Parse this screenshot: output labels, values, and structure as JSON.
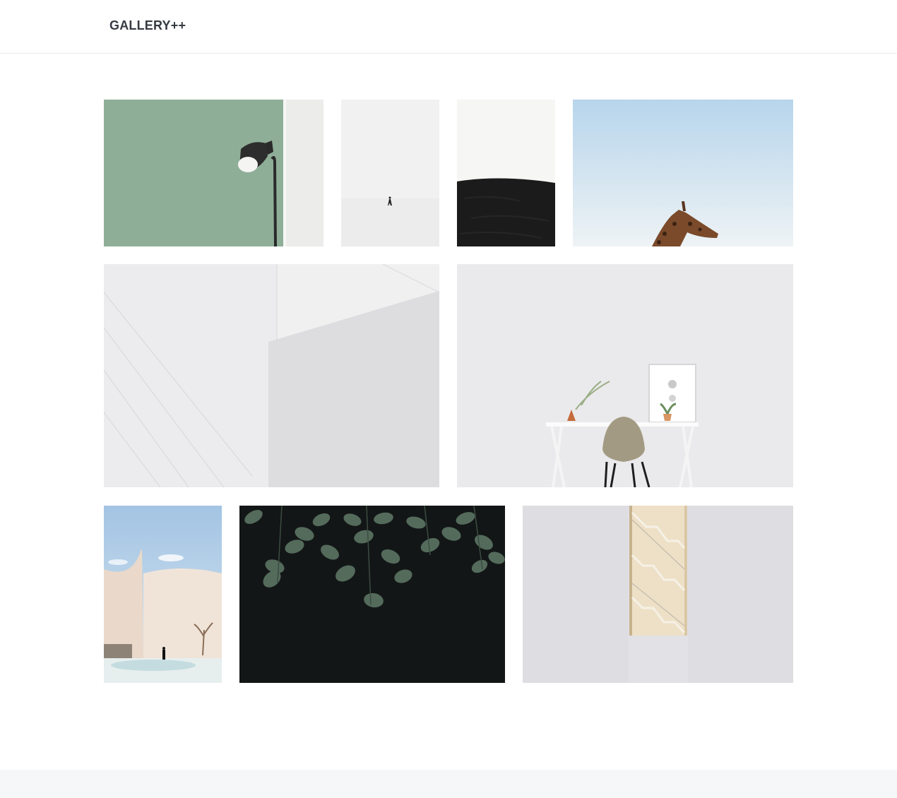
{
  "header": {
    "brand": "GALLERY++"
  },
  "gallery": {
    "photos": [
      {
        "subject": "floor-lamp-against-green-wall",
        "palette": [
          "#8fae98",
          "#ececeb",
          "#2b2b2b"
        ]
      },
      {
        "subject": "lone-person-walking-in-snow",
        "palette": [
          "#f1f1f1",
          "#1c1c1c"
        ]
      },
      {
        "subject": "black-sand-dune-white-sky",
        "palette": [
          "#f5f5f4",
          "#1c1c1c"
        ]
      },
      {
        "subject": "giraffe-against-blue-sky",
        "palette": [
          "#b9d7ec",
          "#e6eef2",
          "#7a4a2a"
        ]
      },
      {
        "subject": "white-architectural-walls",
        "palette": [
          "#ececee",
          "#d9d9dc"
        ]
      },
      {
        "subject": "white-desk-with-beige-chair",
        "palette": [
          "#eaeaec",
          "#a39a83",
          "#ffffff"
        ]
      },
      {
        "subject": "curved-wall-pool-with-figure",
        "palette": [
          "#a8c6e2",
          "#ead9ca",
          "#cfe3e5"
        ]
      },
      {
        "subject": "green-leaves-on-dark-background",
        "palette": [
          "#131616",
          "#546b5c"
        ]
      },
      {
        "subject": "staircase-through-wall-opening",
        "palette": [
          "#dedde1",
          "#e6d6b6"
        ]
      }
    ]
  }
}
